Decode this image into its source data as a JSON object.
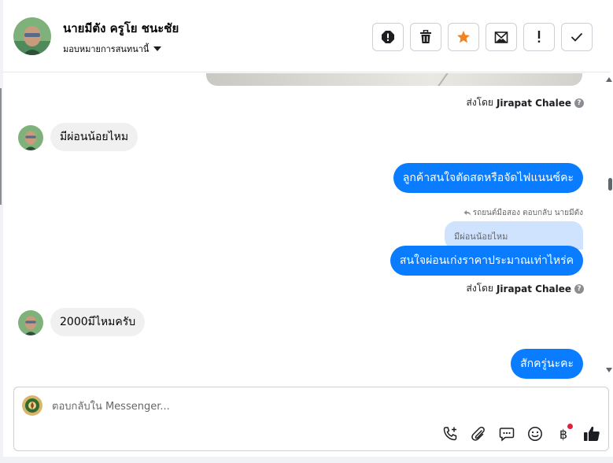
{
  "header": {
    "contact_name": "นายมีตัง ครูโย ชนะชัย",
    "assign_label": "มอบหมายการสนทนานี้",
    "actions": [
      {
        "name": "spam-icon"
      },
      {
        "name": "trash-icon"
      },
      {
        "name": "star-icon"
      },
      {
        "name": "mark-unread-icon"
      },
      {
        "name": "follow-up-icon"
      },
      {
        "name": "done-icon"
      }
    ]
  },
  "conversation": {
    "sent_by_prefix": "ส่งโดย",
    "agent_name": "Jirapat Chalee",
    "messages": [
      {
        "direction": "in",
        "text": "มีผ่อนน้อยไหม"
      },
      {
        "direction": "out",
        "text": "ลูกค้าสนใจตัดสดหรือจัดไฟแนนซ์คะ"
      },
      {
        "direction": "out",
        "text": "สนใจผ่อนเก่งราคาประมาณเท่าไหร่ค"
      },
      {
        "direction": "in",
        "text": "2000มีไหมครับ"
      },
      {
        "direction": "out",
        "text": "สักครู่นะคะ"
      }
    ],
    "reply_meta": "รถยนต์มือสอง ตอบกลับ นายมีตัง",
    "quoted_text": "มีผ่อนน้อยไหม"
  },
  "composer": {
    "placeholder": "ตอบกลับใน Messenger...",
    "value": "",
    "currency_symbol": "฿"
  },
  "colors": {
    "outgoing_bubble": "#0a7cff",
    "incoming_bubble": "#f0f0f0",
    "quoted_bubble": "#cfe3ff",
    "star": "#f5821f",
    "notification_dot": "#e41e3f"
  }
}
